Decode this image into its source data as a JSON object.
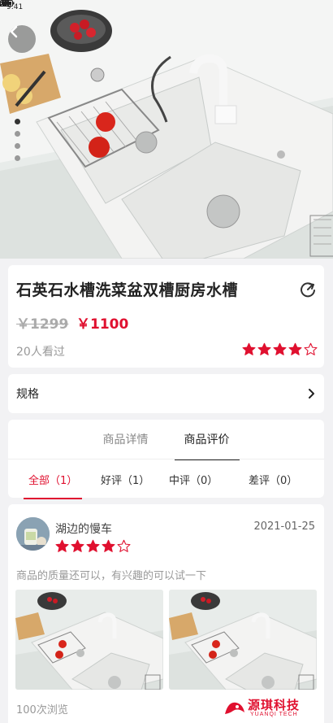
{
  "status_bar": {
    "time": "9:41"
  },
  "product": {
    "title": "石英石水槽洗菜盆双槽厨房水槽",
    "old_price": "￥1299",
    "new_price": "￥1100",
    "views": "20人看过",
    "rating": 4,
    "rating_max": 5
  },
  "gallery": {
    "slide_count": 4,
    "active_index": 0
  },
  "spec": {
    "label": "规格"
  },
  "tabs": [
    {
      "label": "商品详情",
      "active": false
    },
    {
      "label": "商品评价",
      "active": true
    }
  ],
  "filters": [
    {
      "label": "全部（1）",
      "active": true
    },
    {
      "label": "好评（1）",
      "active": false
    },
    {
      "label": "中评（0）",
      "active": false
    },
    {
      "label": "差评（0）",
      "active": false
    }
  ],
  "review": {
    "username": "湖边的慢车",
    "date": "2021-01-25",
    "rating": 4,
    "text": "商品的质量还可以，有兴趣的可以试一下",
    "browse": "100次浏览"
  },
  "watermark": {
    "name": "源琪科技",
    "sub": "YUANQI TECH"
  },
  "colors": {
    "accent": "#e0102f",
    "star": "#e0102f"
  },
  "icons": {
    "back": "chevron-left-icon",
    "share": "share-icon",
    "arrow": "chevron-right-icon",
    "star": "star-icon"
  }
}
